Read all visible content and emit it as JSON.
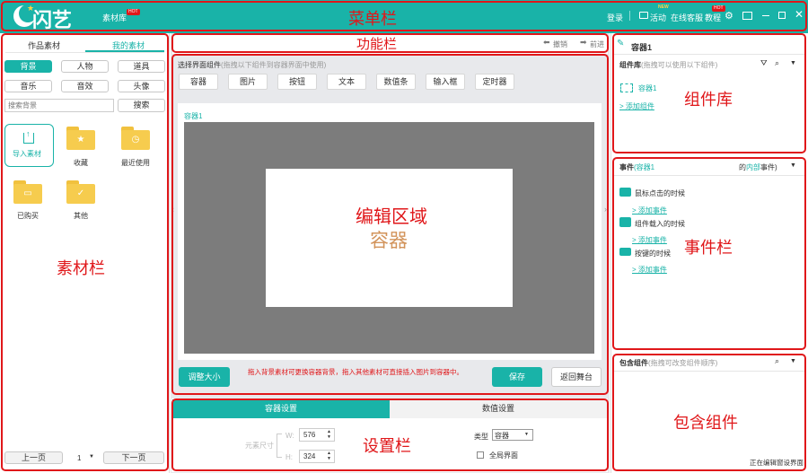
{
  "header": {
    "logo": "闪艺",
    "library": "素材库",
    "hot": "HOT",
    "new": "NEW",
    "login": "登录",
    "activity": "活动",
    "service": "在线客服",
    "tutorial": "教程",
    "overlay": "菜单栏",
    "colors": {
      "brand": "#19b3a8",
      "accent": "#e0171a"
    }
  },
  "left": {
    "tab_works": "作品素材",
    "tab_mine": "我的素材",
    "chips": [
      "背景",
      "人物",
      "道具",
      "音乐",
      "音效",
      "头像"
    ],
    "search_placeholder": "搜索背景",
    "search_btn": "搜索",
    "import": "导入素材",
    "folders": [
      "收藏",
      "最近使用",
      "已购买",
      "其他"
    ],
    "prev": "上一页",
    "page": "1",
    "next": "下一页",
    "overlay": "素材栏"
  },
  "center": {
    "overlay_func": "功能栏",
    "undo": "撤销",
    "redo": "前进",
    "select_label": "选择界面组件",
    "select_hint": "(拖拽以下组件到容器界面中使用)",
    "comps": [
      "容器",
      "图片",
      "按钮",
      "文本",
      "数值条",
      "输入框",
      "定时器"
    ],
    "container_name": "容器1",
    "overlay_edit": "编辑区域",
    "overlay_container": "容器",
    "resize": "调整大小",
    "hint": "拖入背景素材可更换容器背景，拖入其他素材可直接插入图片到容器中。",
    "save": "保存",
    "back": "返回舞台"
  },
  "settings": {
    "tab_container": "容器设置",
    "tab_value": "数值设置",
    "elem_size": "元素尺寸",
    "w_label": "W:",
    "h_label": "H:",
    "w": "576",
    "h": "324",
    "type_label": "类型",
    "type_value": "容器",
    "global": "全局界面",
    "overlay": "设置栏"
  },
  "right": {
    "title": "容器1",
    "lib_label": "组件库",
    "lib_hint": "(拖拽可以使用以下组件)",
    "lib_item": "容器1",
    "lib_add": "> 添加组件",
    "overlay_lib": "组件库",
    "event_label": "事件",
    "event_target": "(容器1",
    "event_of": "的",
    "event_internal": "内部",
    "event_suffix": "事件)",
    "events": [
      {
        "name": "鼠标点击的时候",
        "add": "> 添加事件"
      },
      {
        "name": "组件载入的时候",
        "add": "> 添加事件"
      },
      {
        "name": "按键的时候",
        "add": "> 添加事件"
      }
    ],
    "overlay_event": "事件栏",
    "contains_label": "包含组件",
    "contains_hint": "(拖拽可改变组件顺序)",
    "overlay_contains": "包含组件",
    "status": "正在编辑窗设界面"
  }
}
